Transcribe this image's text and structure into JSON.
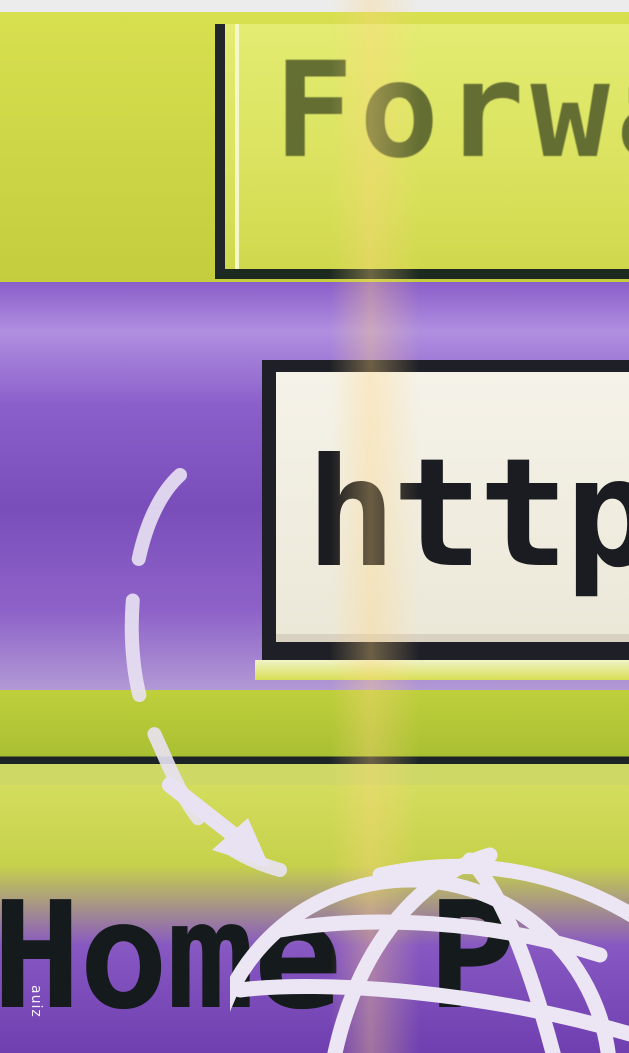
{
  "image": {
    "forward_text": "Forwa",
    "address_text": "http :",
    "home_text": "Home P",
    "credit_text": "auiz",
    "colors": {
      "lime": "#cfd84a",
      "purple": "#8457c4",
      "field_bg": "#f5f2e9",
      "ink": "#1b1c21",
      "globe": "#e9e2f3"
    },
    "icons": [
      "dashed-arc-icon",
      "arrow-icon",
      "globe-icon"
    ]
  }
}
